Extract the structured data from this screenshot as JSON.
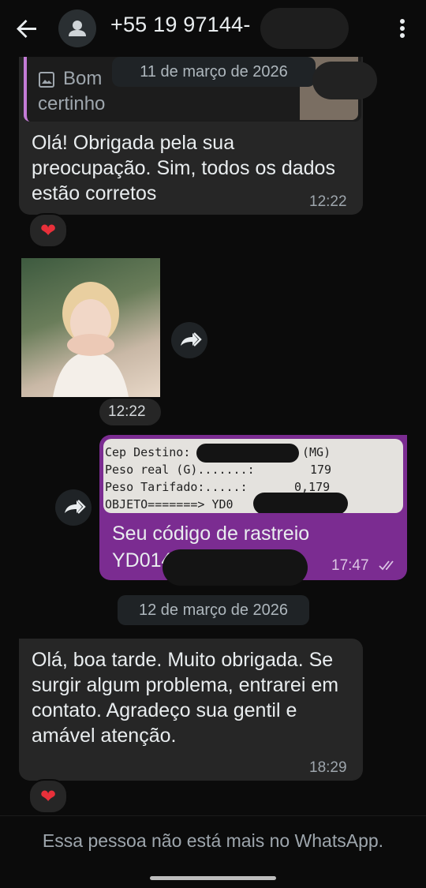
{
  "header": {
    "contact": "+55 19 97144-"
  },
  "messages": {
    "quote_label": "Bom",
    "quote_label2": "certinho",
    "date1": "11 de março de 2026",
    "msg1_text": "Olá! Obrigada pela sua preocupação. Sim, todos os dados estão corretos",
    "msg1_time": "12:22",
    "msg1_reaction": "❤",
    "img_time": "12:22",
    "receipt": {
      "line1_label": "Cep Destino:",
      "line1_value": "(MG)",
      "line2_label": "Peso real (G).......:",
      "line2_value": "179",
      "line3_label": "Peso Tarifado:.....:",
      "line3_value": "0,179",
      "line4_label": "OBJETO=======> YD0"
    },
    "msg2_text": "Seu código de rastreio",
    "msg2_code": "YD014",
    "msg2_time": "17:47",
    "date2": "12 de março de 2026",
    "msg3_text": "Olá, boa tarde. Muito obrigada. Se surgir algum problema, entrarei em contato. Agradeço sua gentil e amável atenção.",
    "msg3_time": "18:29",
    "msg3_reaction": "❤"
  },
  "footer": {
    "notice": "Essa pessoa não está mais no WhatsApp."
  },
  "colors": {
    "outgoing": "#7b2c91",
    "incoming": "#262626",
    "heart": "#e8303a"
  }
}
